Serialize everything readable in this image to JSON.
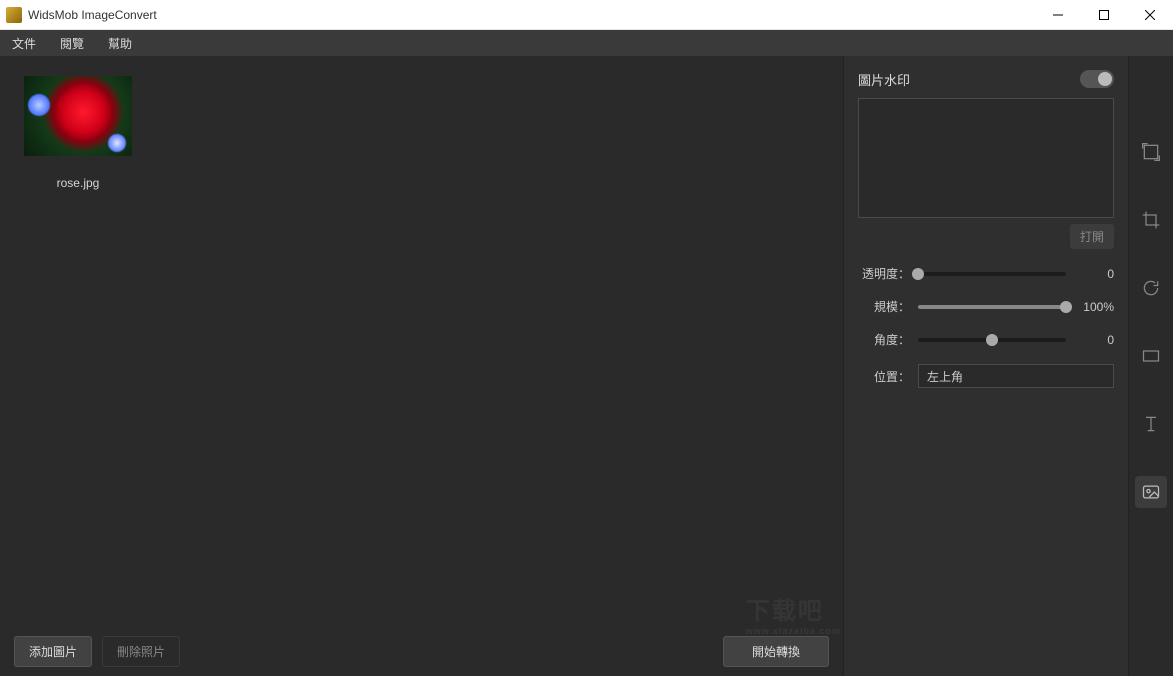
{
  "window": {
    "title": "WidsMob ImageConvert"
  },
  "menu": {
    "file": "文件",
    "view": "閱覽",
    "help": "幫助"
  },
  "thumb": {
    "filename": "rose.jpg"
  },
  "bottom": {
    "add": "添加圖片",
    "remove": "刪除照片",
    "start": "開始轉換"
  },
  "panel": {
    "section_title": "圖片水印",
    "open": "打開",
    "opacity_label": "透明度：",
    "opacity_value": "0",
    "scale_label": "規模：",
    "scale_value": "100%",
    "angle_label": "角度：",
    "angle_value": "0",
    "position_label": "位置：",
    "position_value": "左上角"
  },
  "sliders": {
    "opacity_fill_pct": 0,
    "opacity_thumb_pct": 0,
    "scale_fill_pct": 100,
    "scale_thumb_pct": 100,
    "angle_fill_pct": 0,
    "angle_thumb_pct": 50
  },
  "overlay": {
    "brand": "下载吧",
    "url": "www.xiazaiba.com"
  }
}
